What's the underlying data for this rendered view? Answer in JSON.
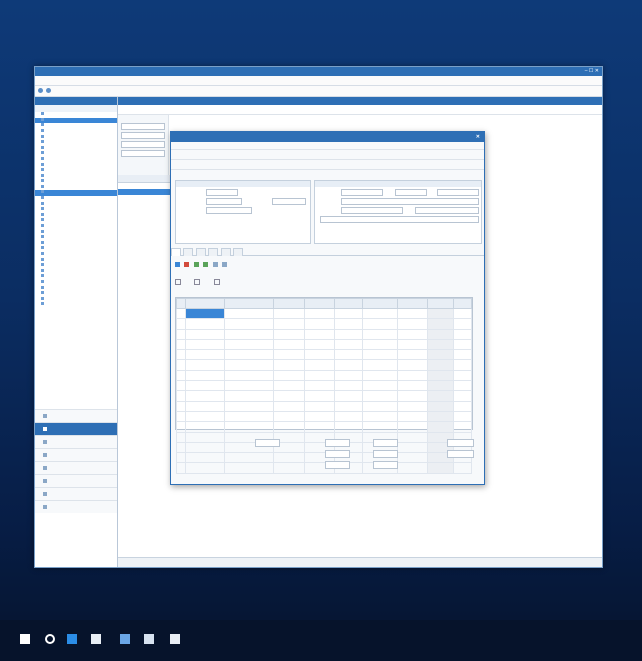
{
  "window": {
    "title": "",
    "controls": "– ☐ ✕"
  },
  "menubar": {
    "items": [
      "",
      "",
      "",
      "",
      "",
      "",
      "",
      "",
      "",
      "",
      ""
    ],
    "user": ""
  },
  "sidebar": {
    "header": "",
    "subheader": "",
    "tree": [
      "",
      "",
      "",
      "",
      "",
      "",
      "",
      "",
      "",
      "",
      "",
      "",
      "",
      "",
      "",
      "",
      "",
      "",
      "",
      "",
      "",
      "",
      "",
      "",
      "",
      "",
      "",
      "",
      "",
      "",
      "",
      "",
      "",
      "",
      ""
    ],
    "nav": [
      "",
      "",
      "",
      "",
      "",
      "",
      "",
      ""
    ]
  },
  "main": {
    "title": "",
    "toolbar": [
      "",
      "",
      "",
      "",
      "",
      ""
    ]
  },
  "dialog": {
    "title": "",
    "menu": [
      "",
      "",
      "",
      "",
      "",
      ""
    ],
    "toolbar": [
      "",
      "",
      "",
      "",
      "",
      "",
      ""
    ],
    "toolbar2": [
      "",
      "",
      "",
      "",
      "",
      ""
    ],
    "tabs": [
      "",
      "",
      "",
      "",
      "",
      ""
    ],
    "grid_headers": [
      "",
      "",
      "",
      "",
      "",
      "",
      "",
      "",
      "",
      ""
    ],
    "totals": [
      "",
      "",
      "",
      "",
      "",
      ""
    ]
  },
  "status": {
    "right": "",
    "clock": ""
  },
  "taskbar": {
    "icons": [
      "windows-icon",
      "search-icon",
      "edge-icon",
      "store-icon",
      "app-icon",
      "app-icon",
      "app-icon"
    ]
  }
}
